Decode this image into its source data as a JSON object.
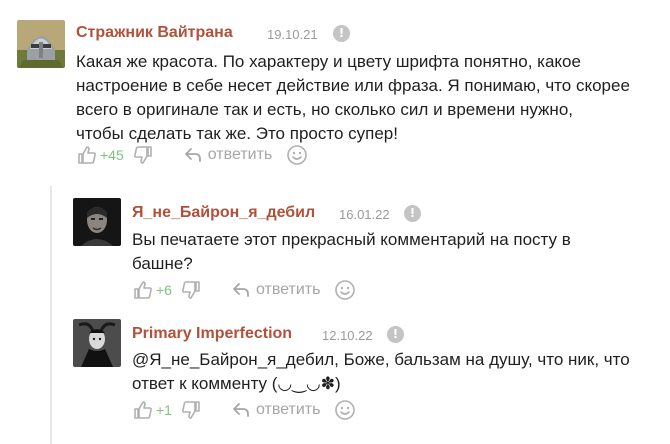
{
  "comments": [
    {
      "author": "Стражник Вайтрана",
      "date": "19.10.21",
      "info_icon": "!",
      "lines": [
        "Какая же красота. По характеру и цвету шрифта понятно, какое",
        "настроение в себе несет действие или фраза. Я понимаю, что скорее",
        "всего в оригинале так и есть, но сколько сил и времени нужно,",
        "чтобы сделать так же. Это просто супер!"
      ],
      "rating": "+45",
      "reply_label": "ответить",
      "avatar": "guard-helmet-avatar"
    },
    {
      "author": "Я_не_Байрон_я_дебил",
      "date": "16.01.22",
      "info_icon": "!",
      "lines": [
        "Вы печатаете этот прекрасный комментарий на посту в",
        "башне?"
      ],
      "rating": "+6",
      "reply_label": "ответить",
      "avatar": "dark-portrait-avatar"
    },
    {
      "author": "Primary Imperfection",
      "date": "12.10.22",
      "info_icon": "!",
      "lines": [
        "@Я_не_Байрон_я_дебил, Боже, бальзам на душу, что ник, что",
        "ответ к комменту (◡‿◡✽)"
      ],
      "rating": "+1",
      "reply_label": "ответить",
      "avatar": "dark-figure-avatar"
    }
  ],
  "colors": {
    "author": "#b1513b",
    "date": "#9a9a9a",
    "rating_positive": "#7cc47d",
    "icon_gray": "#b8b8b8",
    "thread_line": "#e7e7e7"
  }
}
